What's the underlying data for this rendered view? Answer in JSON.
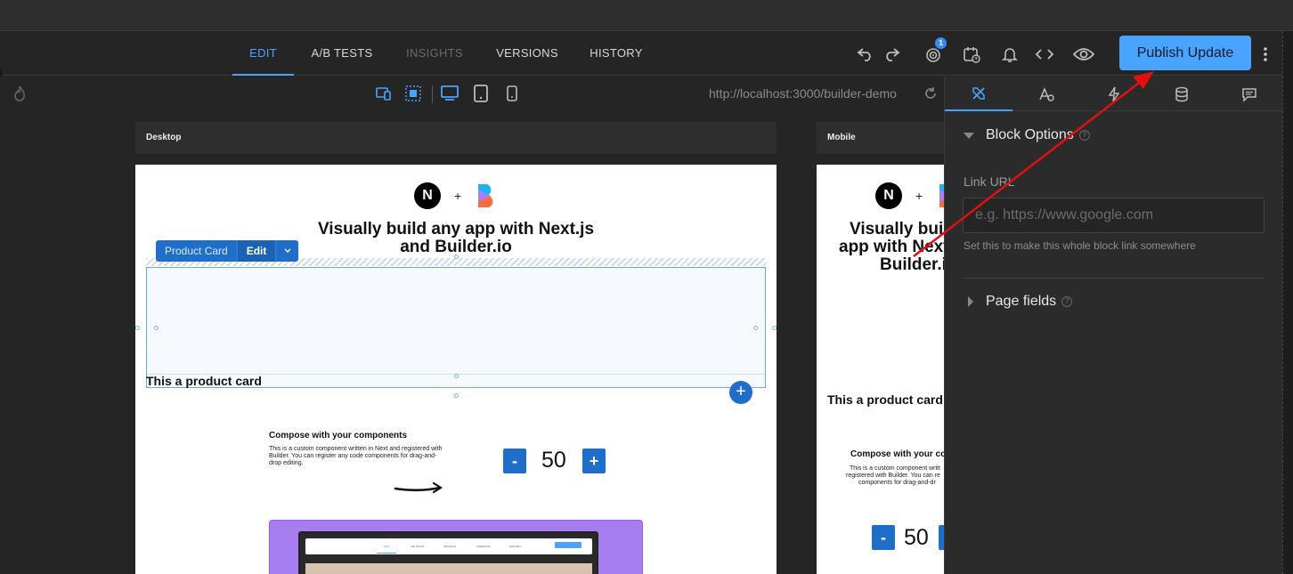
{
  "tabs": [
    {
      "label": "EDIT",
      "state": "active"
    },
    {
      "label": "A/B TESTS",
      "state": "normal"
    },
    {
      "label": "INSIGHTS",
      "state": "disabled"
    },
    {
      "label": "VERSIONS",
      "state": "normal"
    },
    {
      "label": "HISTORY",
      "state": "normal"
    }
  ],
  "header": {
    "publish_label": "Publish Update",
    "targeting_badge": "1",
    "icons": [
      "undo-icon",
      "redo-icon",
      "targeting-icon",
      "schedule-icon",
      "bell-icon",
      "code-icon",
      "eye-icon",
      "more-vertical-icon"
    ]
  },
  "toolbar": {
    "url": "http://localhost:3000/builder-demo",
    "icons": [
      "fire-icon",
      "responsive-icon",
      "select-mode-icon",
      "desktop-icon",
      "tablet-icon",
      "mobile-icon",
      "refresh-icon"
    ]
  },
  "frames": {
    "desktop_label": "Desktop",
    "mobile_label": "Mobile"
  },
  "content": {
    "plus": "+",
    "headline_line1": "Visually build any app with Next.js",
    "headline_line2": "and Builder.io",
    "mobile_headline_line1": "Visually buil",
    "mobile_headline_line2": "app with Next",
    "mobile_headline_line3": "Builder.i",
    "product_title": "This a product card",
    "compose_title": "Compose with your components",
    "compose_body": "This is a custom component written in Next and registered with Builder. You can register any code components for drag-and-drop editing.",
    "mobile_compose_title": "Compose with your co",
    "mobile_compose_body_1": "This is a custom component writt",
    "mobile_compose_body_2": "registered with Builder. You can re",
    "mobile_compose_body_3": "components for drag-and-dr",
    "minus_label": "-",
    "plus_label": "+",
    "counter_value": "50"
  },
  "selection": {
    "chip_label": "Product Card",
    "chip_edit": "Edit",
    "add_symbol": "+"
  },
  "mini_screenshot": {
    "tabs": [
      "EDIT",
      "A/B TESTS",
      "INSIGHTS",
      "VERSIONS",
      "HISTORY"
    ]
  },
  "panel": {
    "tab_icons": [
      "style-icon",
      "animation-icon",
      "interactions-icon",
      "data-icon",
      "comments-icon"
    ],
    "block_options_title": "Block Options",
    "link_url_label": "Link URL",
    "link_url_placeholder": "e.g. https://www.google.com",
    "link_url_value": "",
    "link_url_hint": "Set this to make this whole block link somewhere",
    "page_fields_title": "Page fields",
    "help_glyph": "?"
  },
  "colors": {
    "accent": "#4aa3ff",
    "builder_blue": "#1f6fca",
    "annotation_arrow": "#e01010",
    "purple": "#a87df0"
  }
}
